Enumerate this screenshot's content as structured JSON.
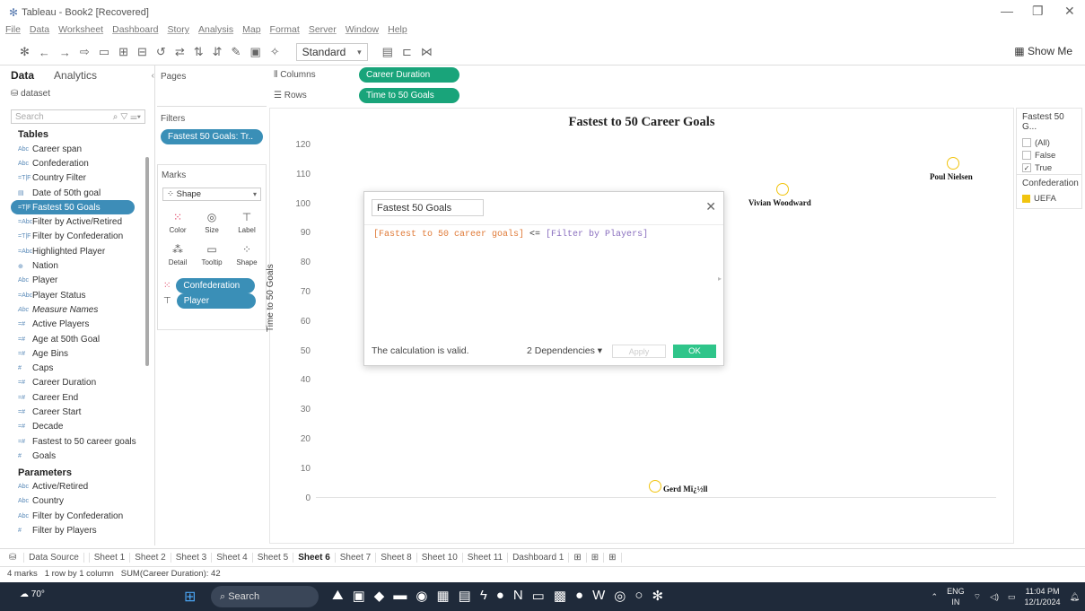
{
  "window": {
    "title": "Tableau - Book2 [Recovered]"
  },
  "menu": [
    "File",
    "Data",
    "Worksheet",
    "Dashboard",
    "Story",
    "Analysis",
    "Map",
    "Format",
    "Server",
    "Window",
    "Help"
  ],
  "toolbar": {
    "standard": "Standard",
    "show_me": "Show Me"
  },
  "data_pane": {
    "tab_data": "Data",
    "tab_analytics": "Analytics",
    "datasource": "dataset",
    "search_placeholder": "Search",
    "tables_header": "Tables",
    "fields": [
      {
        "icon": "Abc",
        "label": "Career span",
        "type": "dim"
      },
      {
        "icon": "Abc",
        "label": "Confederation",
        "type": "dim"
      },
      {
        "icon": "=T|F",
        "label": "Country Filter",
        "type": "calc"
      },
      {
        "icon": "▤",
        "label": "Date of 50th goal",
        "type": "dim"
      },
      {
        "icon": "=T|F",
        "label": "Fastest 50 Goals",
        "type": "calc",
        "highlight": true
      },
      {
        "icon": "=Abc",
        "label": "Filter by Active/Retired",
        "type": "calc"
      },
      {
        "icon": "=T|F",
        "label": "Filter by Confederation",
        "type": "calc"
      },
      {
        "icon": "=Abc",
        "label": "Highlighted Player",
        "type": "calc"
      },
      {
        "icon": "⊕",
        "label": "Nation",
        "type": "dim"
      },
      {
        "icon": "Abc",
        "label": "Player",
        "type": "dim"
      },
      {
        "icon": "=Abc",
        "label": "Player Status",
        "type": "calc"
      },
      {
        "icon": "Abc",
        "label": "Measure Names",
        "type": "dim",
        "italic": true
      },
      {
        "icon": "=#",
        "label": "Active Players",
        "type": "meas"
      },
      {
        "icon": "=#",
        "label": "Age at 50th Goal",
        "type": "meas"
      },
      {
        "icon": "=#",
        "label": "Age Bins",
        "type": "meas"
      },
      {
        "icon": "#",
        "label": "Caps",
        "type": "meas"
      },
      {
        "icon": "=#",
        "label": "Career Duration",
        "type": "meas"
      },
      {
        "icon": "=#",
        "label": "Career End",
        "type": "meas"
      },
      {
        "icon": "=#",
        "label": "Career Start",
        "type": "meas"
      },
      {
        "icon": "=#",
        "label": "Decade",
        "type": "meas"
      },
      {
        "icon": "=#",
        "label": "Fastest to 50 career goals",
        "type": "meas"
      },
      {
        "icon": "#",
        "label": "Goals",
        "type": "meas"
      }
    ],
    "parameters_header": "Parameters",
    "parameters": [
      {
        "icon": "Abc",
        "label": "Active/Retired"
      },
      {
        "icon": "Abc",
        "label": "Country"
      },
      {
        "icon": "Abc",
        "label": "Filter by Confederation"
      },
      {
        "icon": "#",
        "label": "Filter by Players"
      }
    ]
  },
  "cards": {
    "pages": "Pages",
    "filters": "Filters",
    "filter_pill": "Fastest 50 Goals: Tr..",
    "marks": "Marks",
    "mark_type": "Shape",
    "mark_buttons": [
      "Color",
      "Size",
      "Label",
      "Detail",
      "Tooltip",
      "Shape"
    ],
    "mark_pills": [
      "Confederation",
      "Player"
    ]
  },
  "shelves": {
    "columns_label": "Columns",
    "columns_pill": "Career Duration",
    "rows_label": "Rows",
    "rows_pill": "Time to 50 Goals"
  },
  "chart_data": {
    "type": "scatter",
    "title": "Fastest to 50 Career Goals",
    "ylabel": "Time to 50 Goals",
    "xlabel": "",
    "yticks": [
      "120",
      "110",
      "100",
      "90",
      "80",
      "70",
      "60",
      "50",
      "40",
      "30",
      "20",
      "10",
      "0"
    ],
    "ylim": [
      0,
      120
    ],
    "points": [
      {
        "label": "Poul Nielsen",
        "y": 114
      },
      {
        "label": "Vivian Woodward",
        "y": 105
      },
      {
        "label": "Gerd Mï¿½ll",
        "y": 4
      }
    ],
    "mark_color": "#f1c40f"
  },
  "calc_dialog": {
    "name": "Fastest 50 Goals",
    "formula_field1": "[Fastest to 50 career goals]",
    "formula_op": " <= ",
    "formula_field2": "[Filter by Players]",
    "status": "The calculation is valid.",
    "dependencies": "2 Dependencies",
    "apply": "Apply",
    "ok": "OK"
  },
  "legend": {
    "filter_title": "Fastest 50 G...",
    "filter_options": [
      {
        "label": "(All)",
        "checked": false
      },
      {
        "label": "False",
        "checked": false
      },
      {
        "label": "True",
        "checked": true
      }
    ],
    "color_title": "Confederation",
    "color_item": "UEFA",
    "color_item_color": "#f1c40f"
  },
  "sheet_tabs": {
    "datasource": "Data Source",
    "tabs": [
      "Sheet 1",
      "Sheet 2",
      "Sheet 3",
      "Sheet 4",
      "Sheet 5",
      "Sheet 6",
      "Sheet 7",
      "Sheet 8",
      "Sheet 10",
      "Sheet 11",
      "Dashboard 1"
    ],
    "active": "Sheet 6"
  },
  "status": {
    "marks": "4 marks",
    "layout": "1 row by 1 column",
    "sum": "SUM(Career Duration): 42"
  },
  "taskbar": {
    "weather": "70°",
    "search": "Search",
    "lang1": "ENG",
    "lang2": "IN",
    "time": "11:04 PM",
    "date": "12/1/2024"
  }
}
